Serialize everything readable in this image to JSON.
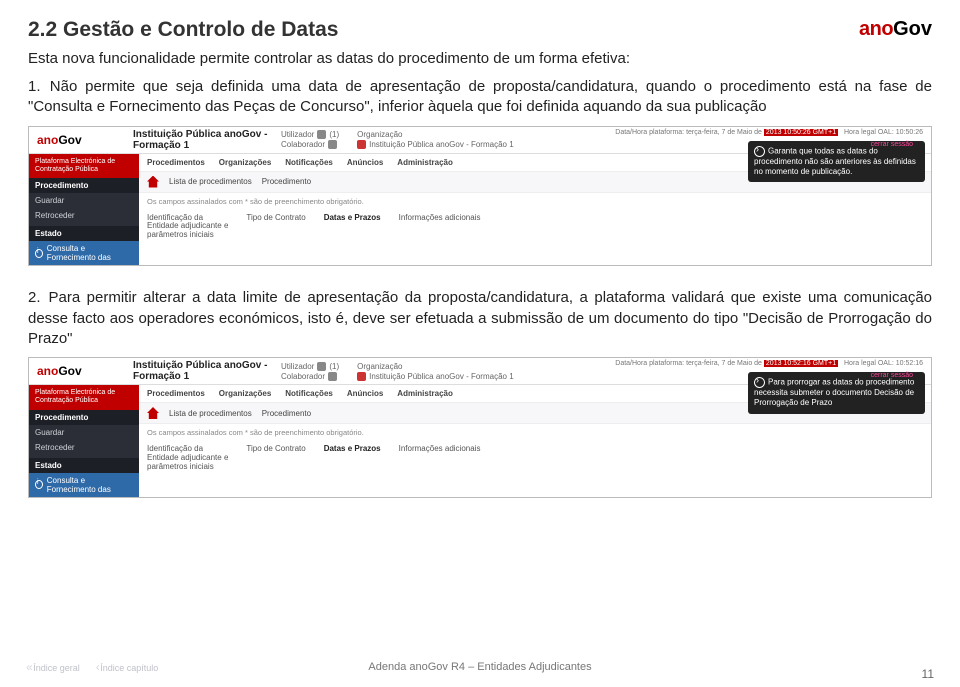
{
  "header": {
    "section_number": "2.2",
    "section_title": "Gestão e Controlo de Datas",
    "brand_ano": "ano",
    "brand_gov": "Gov"
  },
  "intro": "Esta nova funcionalidade permite controlar as datas do procedimento de um forma efetiva:",
  "items": [
    {
      "num": "1.",
      "text": "Não permite que seja definida uma data de apresentação de proposta/candidatura, quando o procedimento está na fase de \"Consulta e Fornecimento das Peças de Concurso\", inferior àquela que foi definida aquando da sua publicação"
    },
    {
      "num": "2.",
      "text": "Para permitir alterar a data limite de apresentação da proposta/candidatura, a plataforma validará que existe uma comunicação desse facto aos operadores económicos, isto é, deve ser efetuada a submissão de um documento do tipo \"Decisão de Prorrogação do Prazo\""
    }
  ],
  "screenshot": {
    "institution_line1": "Instituição Pública anoGov -",
    "institution_line2": "Formação 1",
    "utilizador_label": "Utilizador",
    "utilizador_value": "(1)",
    "colaborador_label": "Colaborador",
    "organizacao_label": "Organização",
    "organizacao_value": "Instituição Pública anoGov - Formação 1",
    "date_line": "Data/Hora plataforma: terça-feira, 7 de Maio de",
    "date_hl": "2013 10:50:26 GMT+1",
    "hora_legal": "Hora legal OAL: 10:50:26",
    "sessao": "cerrar sessão",
    "red_band_l1": "Plataforma Electrónica de",
    "red_band_l2": "Contratação Pública",
    "left_procedimento": "Procedimento",
    "left_guardar": "Guardar",
    "left_retroceder": "Retroceder",
    "left_estado": "Estado",
    "left_consulta": "Consulta e Fornecimento das",
    "tabs": [
      "Procedimentos",
      "Organizações",
      "Notificações",
      "Anúncios",
      "Administração"
    ],
    "sub_list": "Lista de procedimentos",
    "sub_proc": "Procedimento",
    "req_note": "Os campos assinalados com * são de preenchimento obrigatório.",
    "inner_tabs": {
      "t1_l1": "Identificação da",
      "t1_l2": "Entidade adjudicante e",
      "t1_l3": "parâmetros iniciais",
      "t2": "Tipo de Contrato",
      "t3": "Datas e Prazos",
      "t4": "Informações adicionais"
    }
  },
  "tooltip1": {
    "line": "Garanta que todas as datas do procedimento não são anteriores às definidas no momento de publicação."
  },
  "screenshot2": {
    "date_hl": "2013 10:52:16 GMT+1",
    "hora_legal": "Hora legal OAL: 10:52:16"
  },
  "tooltip2": {
    "line": "Para prorrogar as datas do procedimento necessita submeter o documento Decisão de Prorrogação de Prazo"
  },
  "footer": {
    "indice_geral": "Índice geral",
    "indice_capitulo": "Índice capítulo",
    "center": "Adenda anoGov R4 – Entidades Adjudicantes",
    "page": "11"
  }
}
